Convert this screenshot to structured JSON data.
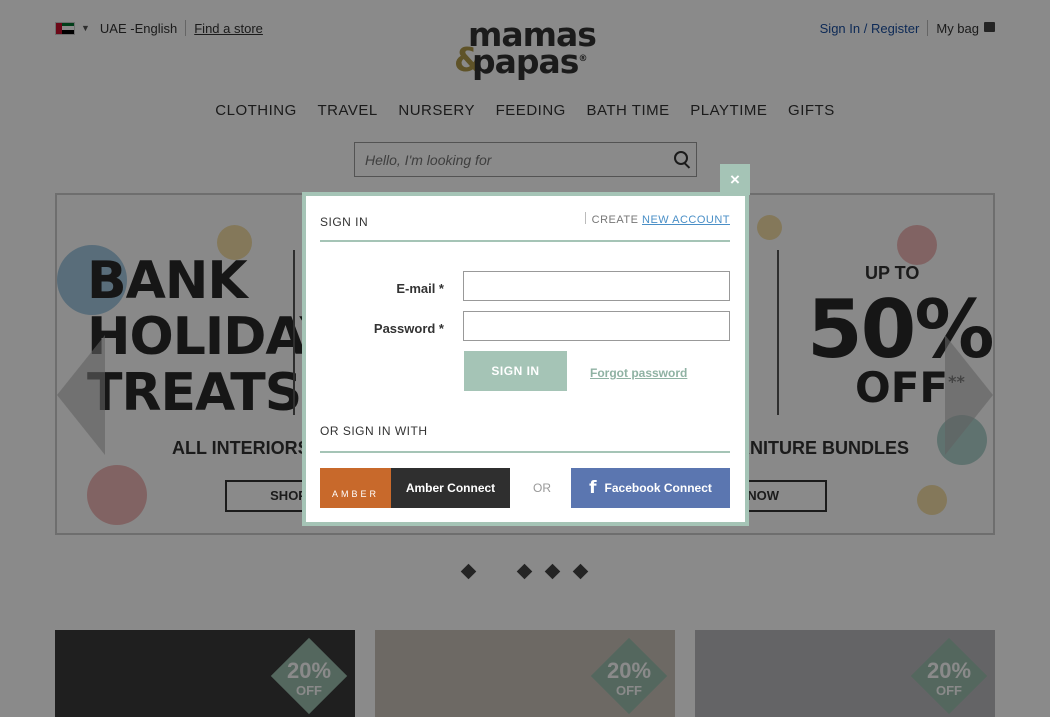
{
  "topbar": {
    "locale_label": "UAE -English",
    "find_store": "Find a store",
    "sign_in_register": "Sign In / Register",
    "my_bag": "My bag"
  },
  "logo": {
    "line1": "mamas",
    "amp": "&",
    "line2": "papas",
    "mark": "®"
  },
  "nav": [
    "CLOTHING",
    "TRAVEL",
    "NURSERY",
    "FEEDING",
    "BATH TIME",
    "PLAYTIME",
    "GIFTS"
  ],
  "search": {
    "placeholder": "Hello, I'm looking for"
  },
  "banner": {
    "left_title_1": "BANK",
    "left_title_2": "HOLIDAY",
    "left_title_3": "TREATS",
    "left_sub": "ALL INTERIORS",
    "left_cta": "SHOP NO",
    "right_upto": "UP TO",
    "right_big": "50%",
    "right_off": "OFF",
    "right_stars": "**",
    "right_sub": "RNITURE BUNDLES",
    "right_cta": "OP NOW"
  },
  "tiles": [
    {
      "discount": "20%",
      "off": "OFF"
    },
    {
      "discount": "20%",
      "off": "OFF"
    },
    {
      "discount": "20%",
      "off": "OFF"
    }
  ],
  "modal": {
    "title": "SIGN IN",
    "create_prefix": "CREATE",
    "new_account": "NEW ACCOUNT",
    "email_label": "E-mail *",
    "password_label": "Password *",
    "email_value": "",
    "password_value": "",
    "signin_button": "SIGN IN",
    "forgot_password": "Forgot password",
    "or_sign_in_with": "OR SIGN IN WITH",
    "amber_logo": "AMBER",
    "amber_connect": "Amber Connect",
    "or": "OR",
    "facebook_icon": "f",
    "facebook_connect": "Facebook Connect",
    "close": "×"
  },
  "colors": {
    "accent": "#a5c4b6",
    "link_blue": "#4a8fc7",
    "facebook": "#5b76b0",
    "amber": "#c8692b"
  }
}
